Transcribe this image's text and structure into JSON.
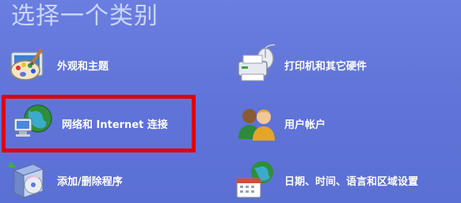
{
  "header": {
    "title": "选择一个类别"
  },
  "categories": [
    {
      "label": "外观和主题",
      "icon": "appearance-themes-icon"
    },
    {
      "label": "打印机和其它硬件",
      "icon": "printer-hardware-icon"
    },
    {
      "label": "网络和 Internet 连接",
      "icon": "network-internet-icon",
      "highlighted": true
    },
    {
      "label": "用户帐户",
      "icon": "user-accounts-icon"
    },
    {
      "label": "添加/删除程序",
      "icon": "add-remove-programs-icon"
    },
    {
      "label": "日期、时间、语言和区域设置",
      "icon": "date-time-language-icon"
    }
  ],
  "colors": {
    "background": "#6275d9",
    "highlight": "#e00000",
    "title": "#c9d6ff"
  }
}
